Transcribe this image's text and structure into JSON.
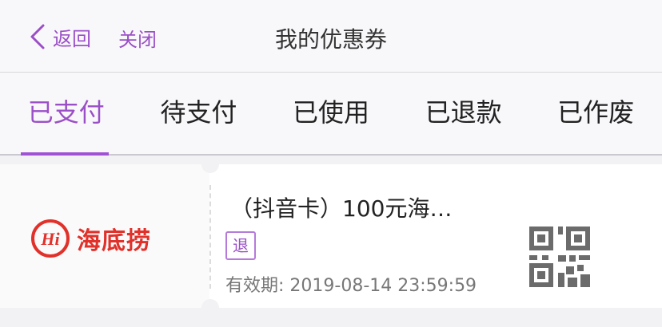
{
  "nav": {
    "back_label": "返回",
    "close_label": "关闭",
    "title": "我的优惠券"
  },
  "tabs": [
    {
      "label": "已支付",
      "active": true
    },
    {
      "label": "待支付",
      "active": false
    },
    {
      "label": "已使用",
      "active": false
    },
    {
      "label": "已退款",
      "active": false
    },
    {
      "label": "已作废",
      "active": false
    }
  ],
  "coupon": {
    "brand": "海底捞",
    "logo_mark": "Hi",
    "title": "（抖音卡）100元海…",
    "badge": "退",
    "validity": "有效期: 2019-08-14 23:59:59",
    "qr_icon": "qr-code-icon"
  },
  "colors": {
    "accent": "#9b4fc7",
    "brand_red": "#e0312a"
  }
}
